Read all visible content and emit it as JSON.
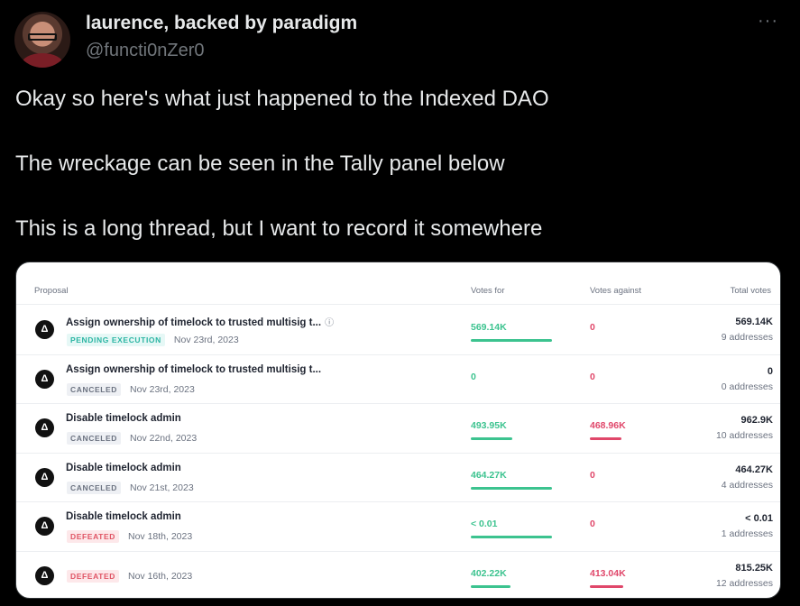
{
  "tweet": {
    "author_name": "laurence, backed by paradigm",
    "author_handle": "@functi0nZer0",
    "more_label": "···",
    "lines": [
      "Okay so here's what just happened to the Indexed DAO",
      "The wreckage can be seen in the Tally panel below",
      "This is a long thread, but I want to record it somewhere"
    ]
  },
  "panel": {
    "headers": {
      "proposal": "Proposal",
      "votes_for": "Votes for",
      "votes_against": "Votes against",
      "total_votes": "Total votes"
    },
    "logo_glyph": "Δ",
    "info_glyph": "ⓘ",
    "rows": [
      {
        "title": "Assign ownership of timelock to trusted multisig t...",
        "status": "PENDING EXECUTION",
        "status_type": "pending",
        "date": "Nov 23rd, 2023",
        "votes_for": "569.14K",
        "votes_against": "0",
        "total": "569.14K",
        "addresses": "9 addresses",
        "for_fraction": 1.0,
        "against_fraction": 0.0,
        "show_info": true
      },
      {
        "title": "Assign ownership of timelock to trusted multisig t...",
        "status": "CANCELED",
        "status_type": "canceled",
        "date": "Nov 23rd, 2023",
        "votes_for": "0",
        "votes_against": "0",
        "total": "0",
        "addresses": "0 addresses",
        "for_fraction": 0.0,
        "against_fraction": 0.0,
        "show_info": false
      },
      {
        "title": "Disable timelock admin",
        "status": "CANCELED",
        "status_type": "canceled",
        "date": "Nov 22nd, 2023",
        "votes_for": "493.95K",
        "votes_against": "468.96K",
        "total": "962.9K",
        "addresses": "10 addresses",
        "for_fraction": 0.51,
        "against_fraction": 0.49,
        "show_info": false
      },
      {
        "title": "Disable timelock admin",
        "status": "CANCELED",
        "status_type": "canceled",
        "date": "Nov 21st, 2023",
        "votes_for": "464.27K",
        "votes_against": "0",
        "total": "464.27K",
        "addresses": "4 addresses",
        "for_fraction": 1.0,
        "against_fraction": 0.0,
        "show_info": false
      },
      {
        "title": "Disable timelock admin",
        "status": "DEFEATED",
        "status_type": "defeated",
        "date": "Nov 18th, 2023",
        "votes_for": "< 0.01",
        "votes_against": "0",
        "total": "< 0.01",
        "addresses": "1 addresses",
        "for_fraction": 1.0,
        "against_fraction": 0.0,
        "show_info": false
      },
      {
        "title": "",
        "status": "DEFEATED",
        "status_type": "defeated",
        "date": "Nov 16th, 2023",
        "votes_for": "402.22K",
        "votes_against": "413.04K",
        "total": "815.25K",
        "addresses": "12 addresses",
        "for_fraction": 0.49,
        "against_fraction": 0.51,
        "show_info": false
      }
    ]
  }
}
